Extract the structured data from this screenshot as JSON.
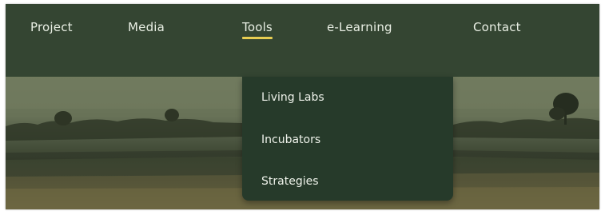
{
  "nav": {
    "items": [
      {
        "label": "Project"
      },
      {
        "label": "Media"
      },
      {
        "label": "Tools",
        "active": true
      },
      {
        "label": "e-Learning"
      },
      {
        "label": "Contact"
      }
    ]
  },
  "dropdown": {
    "parent": "Tools",
    "items": [
      {
        "label": "Living Labs"
      },
      {
        "label": "Incubators"
      },
      {
        "label": "Strategies"
      }
    ]
  },
  "colors": {
    "navbar": "#344532",
    "dropdown": "#263a2a",
    "accent_underline": "#e7cd52",
    "text": "#e9efe4"
  }
}
